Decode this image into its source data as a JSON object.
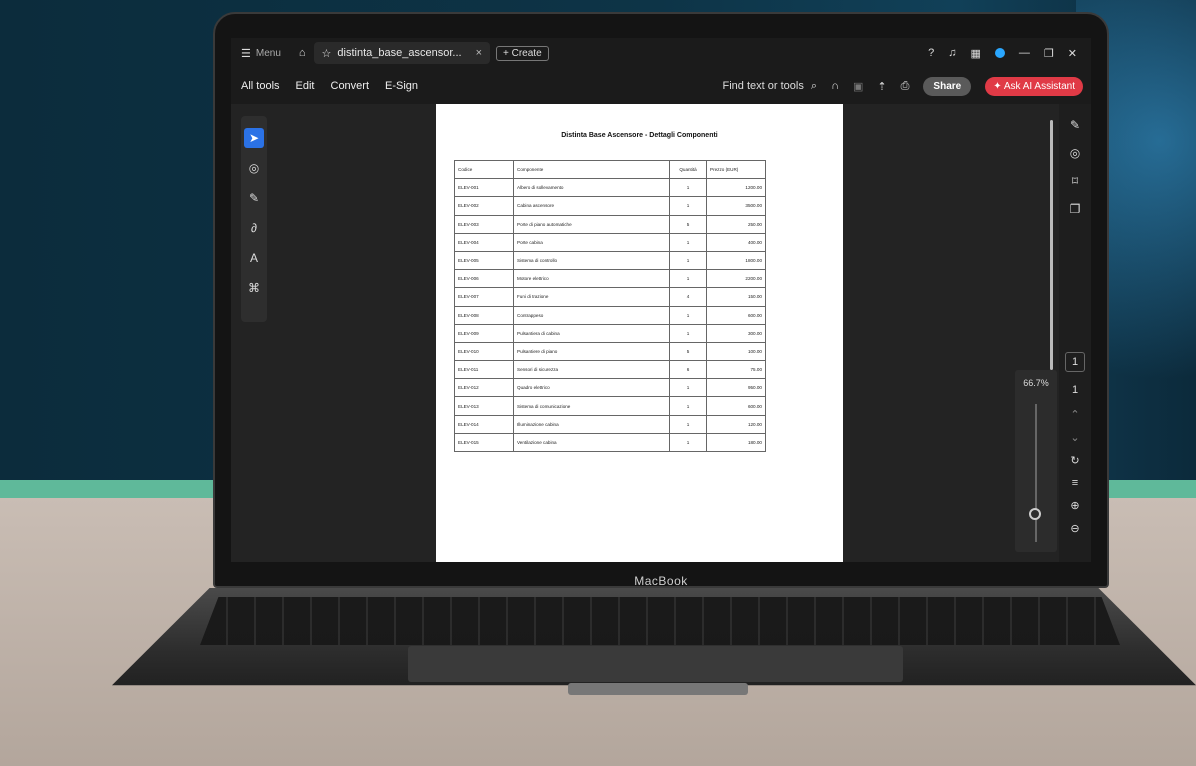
{
  "app": {
    "menu_label": "Menu",
    "tab_title": "distinta_base_ascensor...",
    "tab_close": "×",
    "create_label": "Create"
  },
  "menubar": {
    "items": [
      "All tools",
      "Edit",
      "Convert",
      "E-Sign"
    ],
    "find": "Find text or tools",
    "share": "Share",
    "ask_ai": "Ask AI Assistant"
  },
  "device": {
    "brand": "MacBook"
  },
  "viewer": {
    "current_page": "1",
    "total_pages": "1",
    "zoom": "66.7%"
  },
  "document": {
    "title": "Distinta Base Ascensore - Dettagli Componenti",
    "columns": [
      "Codice",
      "Componente",
      "Quantità",
      "Prezzo (EUR)"
    ],
    "rows": [
      [
        "ELEV-001",
        "Albero di sollevamento",
        "1",
        "1200.00"
      ],
      [
        "ELEV-002",
        "Cabina ascensore",
        "1",
        "3500.00"
      ],
      [
        "ELEV-003",
        "Porte di piano automatiche",
        "5",
        "250.00"
      ],
      [
        "ELEV-004",
        "Porte cabina",
        "1",
        "400.00"
      ],
      [
        "ELEV-005",
        "Sistema di controllo",
        "1",
        "1800.00"
      ],
      [
        "ELEV-006",
        "Motore elettrico",
        "1",
        "2200.00"
      ],
      [
        "ELEV-007",
        "Funi di trazione",
        "4",
        "150.00"
      ],
      [
        "ELEV-008",
        "Contrappeso",
        "1",
        "600.00"
      ],
      [
        "ELEV-009",
        "Pulsantiera di cabina",
        "1",
        "300.00"
      ],
      [
        "ELEV-010",
        "Pulsantiere di piano",
        "5",
        "100.00"
      ],
      [
        "ELEV-011",
        "Sensori di sicurezza",
        "6",
        "75.00"
      ],
      [
        "ELEV-012",
        "Quadro elettrico",
        "1",
        "950.00"
      ],
      [
        "ELEV-013",
        "Sistema di comunicazione",
        "1",
        "600.00"
      ],
      [
        "ELEV-014",
        "Illuminazione cabina",
        "1",
        "120.00"
      ],
      [
        "ELEV-015",
        "Ventilazione cabina",
        "1",
        "180.00"
      ]
    ]
  }
}
